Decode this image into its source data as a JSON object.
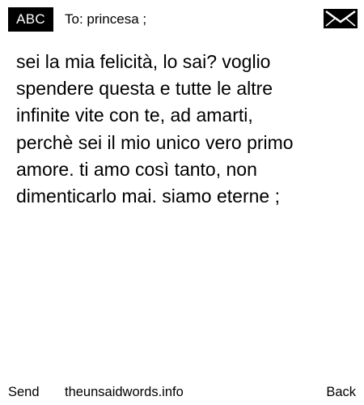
{
  "header": {
    "mode_label": "ABC",
    "recipient": "To: princesa ;",
    "icon": "envelope-icon"
  },
  "message": {
    "body": "sei la mia felicità, lo sai? voglio\nspendere questa e tutte le altre\ninfinite vite con te, ad amarti,\nperchè sei il mio unico vero primo\namore. ti amo così tanto, non\ndimenticarlo mai. siamo eterne ;"
  },
  "footer": {
    "send_label": "Send",
    "site_label": "theunsaidwords.info",
    "back_label": "Back"
  },
  "colors": {
    "background": "#ffffff",
    "text": "#000000",
    "badge_background": "#000000",
    "badge_text": "#ffffff"
  }
}
